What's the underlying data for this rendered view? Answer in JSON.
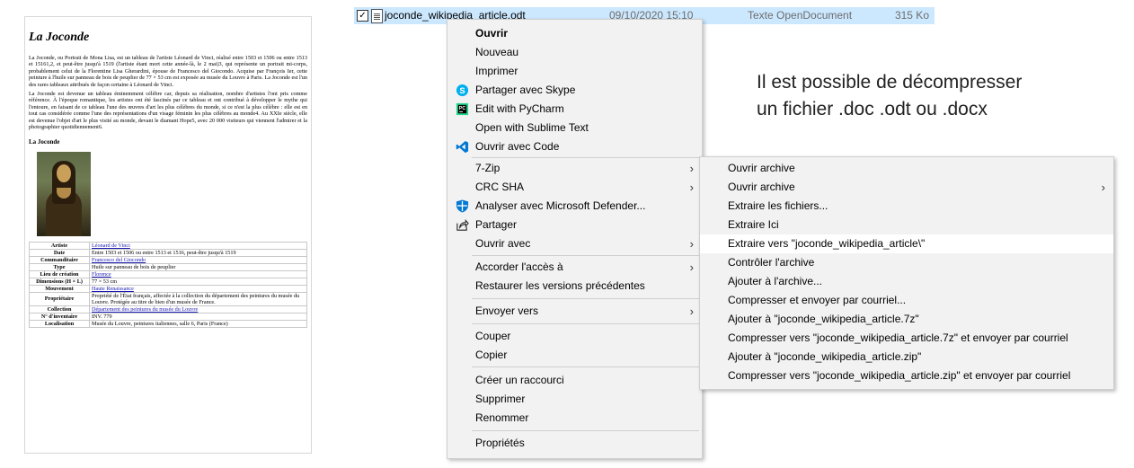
{
  "file_row": {
    "checked": "✓",
    "name": "joconde_wikipedia_article.odt",
    "date": "09/10/2020 15:10",
    "type": "Texte OpenDocument",
    "size": "315 Ko"
  },
  "document": {
    "title": "La Joconde",
    "para1": "La Joconde, ou Portrait de Mona Lisa, est un tableau de l'artiste Léonard de Vinci, réalisé entre 1503 et 1506 ou entre 1513 et 15161,2, et peut-être jusqu'à 1519 (l'artiste étant mort cette année-là, le 2 mai)3, qui représente un portrait mi-corps, probablement celui de la Florentine Lisa Gherardini, épouse de Francesco del Giocondo. Acquise par François Ier, cette peinture à l'huile sur panneau de bois de peuplier de 77 × 53 cm est exposée au musée du Louvre à Paris. La Joconde est l'un des rares tableaux attribués de façon certaine à Léonard de Vinci.",
    "para2": "La Joconde est devenue un tableau éminemment célèbre car, depuis sa réalisation, nombre d'artistes l'ont pris comme référence. À l'époque romantique, les artistes ont été fascinés par ce tableau et ont contribué à développer le mythe qui l'entoure, en faisant de ce tableau l'une des œuvres d'art les plus célèbres du monde, si ce n'est la plus célèbre : elle est en tout cas considérée comme l'une des représentations d'un visage féminin les plus célèbres au monde4. Au XXIe siècle, elle est devenue l'objet d'art le plus visité au monde, devant le diamant Hope5, avec 20 000 visiteurs qui viennent l'admirer et la photographier quotidiennement6.",
    "caption": "La Joconde",
    "infobox": [
      {
        "k": "Artiste",
        "v": "Léonard de Vinci"
      },
      {
        "k": "Date",
        "v": "Entre 1503 et 1506 ou entre 1513 et 1516, peut-être jusqu'à 1519"
      },
      {
        "k": "Commanditaire",
        "v": "Francesco del Giocondo"
      },
      {
        "k": "Type",
        "v": "Huile sur panneau de bois de peuplier"
      },
      {
        "k": "Lieu de création",
        "v": "Florence"
      },
      {
        "k": "Dimensions (H × L)",
        "v": "77 × 53 cm"
      },
      {
        "k": "Mouvement",
        "v": "Haute Renaissance"
      },
      {
        "k": "Propriétaire",
        "v": "Propriété de l'État français, affectée à la collection du département des peintures du musée du Louvre. Protégée au titre de bien d'un musée de France."
      },
      {
        "k": "Collection",
        "v": "Département des peintures du musée du Louvre"
      },
      {
        "k": "N° d'inventaire",
        "v": "INV. 779"
      },
      {
        "k": "Localisation",
        "v": "Musée du Louvre, peintures italiennes, salle 6, Paris (France)"
      }
    ]
  },
  "context_menu": {
    "items": [
      {
        "label": "Ouvrir"
      },
      {
        "label": "Nouveau"
      },
      {
        "label": "Imprimer"
      },
      {
        "label": "Partager avec Skype",
        "icon": "skype-icon"
      },
      {
        "label": "Edit with PyCharm",
        "icon": "pycharm-icon"
      },
      {
        "label": "Open with Sublime Text"
      },
      {
        "label": "Ouvrir avec Code",
        "icon": "vscode-icon"
      },
      {
        "label": "7-Zip"
      },
      {
        "label": "CRC SHA"
      },
      {
        "label": "Analyser avec Microsoft Defender...",
        "icon": "defender-shield-icon"
      },
      {
        "label": "Partager",
        "icon": "share-icon"
      },
      {
        "label": "Ouvrir avec"
      },
      {
        "label": "Accorder l'accès à"
      },
      {
        "label": "Restaurer les versions précédentes"
      },
      {
        "label": "Envoyer vers"
      },
      {
        "label": "Couper"
      },
      {
        "label": "Copier"
      },
      {
        "label": "Créer un raccourci"
      },
      {
        "label": "Supprimer"
      },
      {
        "label": "Renommer"
      },
      {
        "label": "Propriétés"
      }
    ],
    "arrow": "›"
  },
  "submenu_7zip": {
    "items": [
      {
        "label": "Ouvrir archive"
      },
      {
        "label": "Ouvrir archive"
      },
      {
        "label": "Extraire les fichiers..."
      },
      {
        "label": "Extraire Ici"
      },
      {
        "label": "Extraire vers \"joconde_wikipedia_article\\\""
      },
      {
        "label": "Contrôler l'archive"
      },
      {
        "label": "Ajouter à l'archive..."
      },
      {
        "label": "Compresser et envoyer par courriel..."
      },
      {
        "label": "Ajouter à \"joconde_wikipedia_article.7z\""
      },
      {
        "label": "Compresser vers \"joconde_wikipedia_article.7z\" et envoyer par courriel"
      },
      {
        "label": "Ajouter à \"joconde_wikipedia_article.zip\""
      },
      {
        "label": "Compresser vers \"joconde_wikipedia_article.zip\" et envoyer par courriel"
      }
    ]
  },
  "note": {
    "line1": "Il est possible de décompresser",
    "line2": "un fichier .doc .odt ou .docx"
  },
  "colors": {
    "selection": "#cce8ff",
    "menu_bg": "#f2f2f2",
    "link": "#1a1ab4",
    "skype": "#00aff0",
    "vscode": "#0078d4",
    "defender": "#0078d4"
  }
}
